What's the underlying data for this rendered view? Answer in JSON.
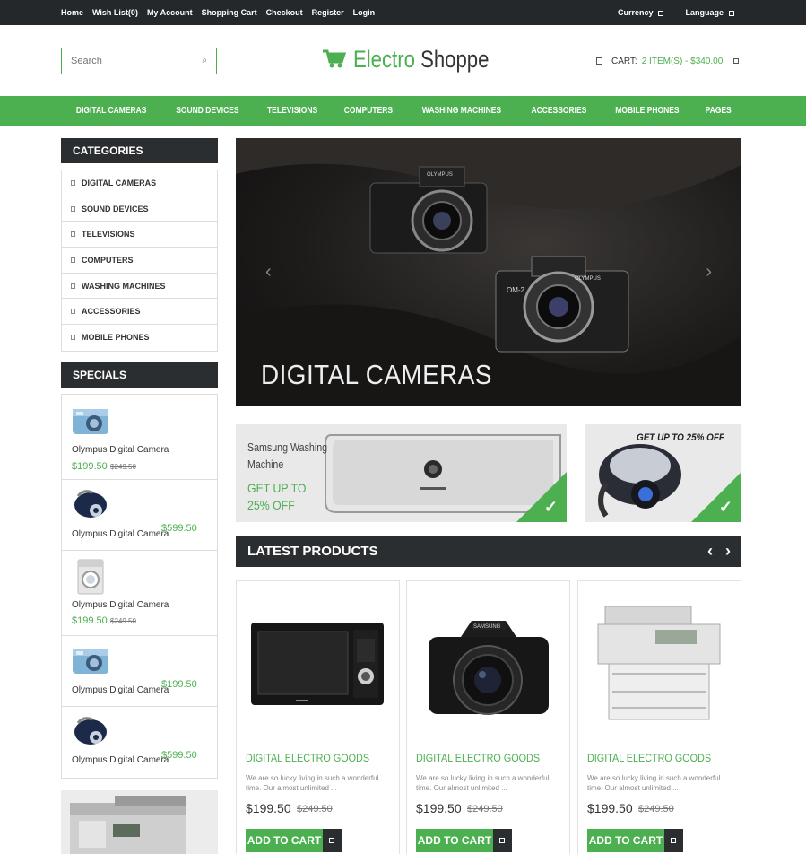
{
  "topbar": {
    "links": [
      "Home",
      "Wish List(0)",
      "My Account",
      "Shopping Cart",
      "Checkout",
      "Register",
      "Login"
    ],
    "currency_label": "Currency",
    "language_label": "Language"
  },
  "header": {
    "search_placeholder": "Search",
    "logo_part1": "Electro",
    "logo_part2": "Shoppe",
    "cart_label": "CART:",
    "cart_value": "2 ITEM(S) - $340.00"
  },
  "nav": {
    "items": [
      "DIGITAL CAMERAS",
      "SOUND DEVICES",
      "TELEVISIONS",
      "COMPUTERS",
      "WASHING MACHINES",
      "ACCESSORIES",
      "MOBILE PHONES",
      "PAGES"
    ]
  },
  "sidebar": {
    "categories_title": "CATEGORIES",
    "categories": [
      "DIGITAL CAMERAS",
      "SOUND DEVICES",
      "TELEVISIONS",
      "COMPUTERS",
      "WASHING MACHINES",
      "ACCESSORIES",
      "MOBILE PHONES"
    ],
    "specials_title": "SPECIALS",
    "specials": [
      {
        "name": "Olympus Digital Camera",
        "price": "$199.50",
        "old_price": "$249.50",
        "icon": "blue-camera"
      },
      {
        "name": "Olympus Digital Camera",
        "price": "$599.50",
        "old_price": "",
        "icon": "vacuum-cleaner"
      },
      {
        "name": "Olympus Digital Camera",
        "price": "$199.50",
        "old_price": "$249.50",
        "icon": "washing-machine"
      },
      {
        "name": "Olympus Digital Camera",
        "price": "$199.50",
        "old_price": "",
        "icon": "blue-camera"
      },
      {
        "name": "Olympus Digital Camera",
        "price": "$599.50",
        "old_price": "",
        "icon": "vacuum-cleaner"
      }
    ]
  },
  "slider": {
    "title": "DIGITAL CAMERAS",
    "prev": "‹",
    "next": "›"
  },
  "banners": {
    "left_line1": "Samsung Washing",
    "left_line2": "Machine",
    "left_offer1": "GET UP TO",
    "left_offer2": "25% OFF",
    "right_offer": "GET UP TO 25% OFF"
  },
  "latest": {
    "title": "LATEST PRODUCTS",
    "products": [
      {
        "title": "DIGITAL ELECTRO GOODS",
        "desc": "We are so lucky living in such a wonderful time. Our almost unlimited ...",
        "price": "$199.50",
        "old_price": "$249.50",
        "button": "ADD TO CART",
        "icon": "microwave"
      },
      {
        "title": "DIGITAL ELECTRO GOODS",
        "desc": "We are so lucky living in such a wonderful time. Our almost unlimited ...",
        "price": "$199.50",
        "old_price": "$249.50",
        "button": "ADD TO CART",
        "icon": "dslr-camera"
      },
      {
        "title": "DIGITAL ELECTRO GOODS",
        "desc": "We are so lucky living in such a wonderful time. Our almost unlimited ...",
        "price": "$199.50",
        "old_price": "$249.50",
        "button": "ADD TO CART",
        "icon": "printer"
      }
    ]
  },
  "colors": {
    "accent": "#4caf50",
    "dark": "#2a2e31",
    "topbar": "#24282b"
  }
}
